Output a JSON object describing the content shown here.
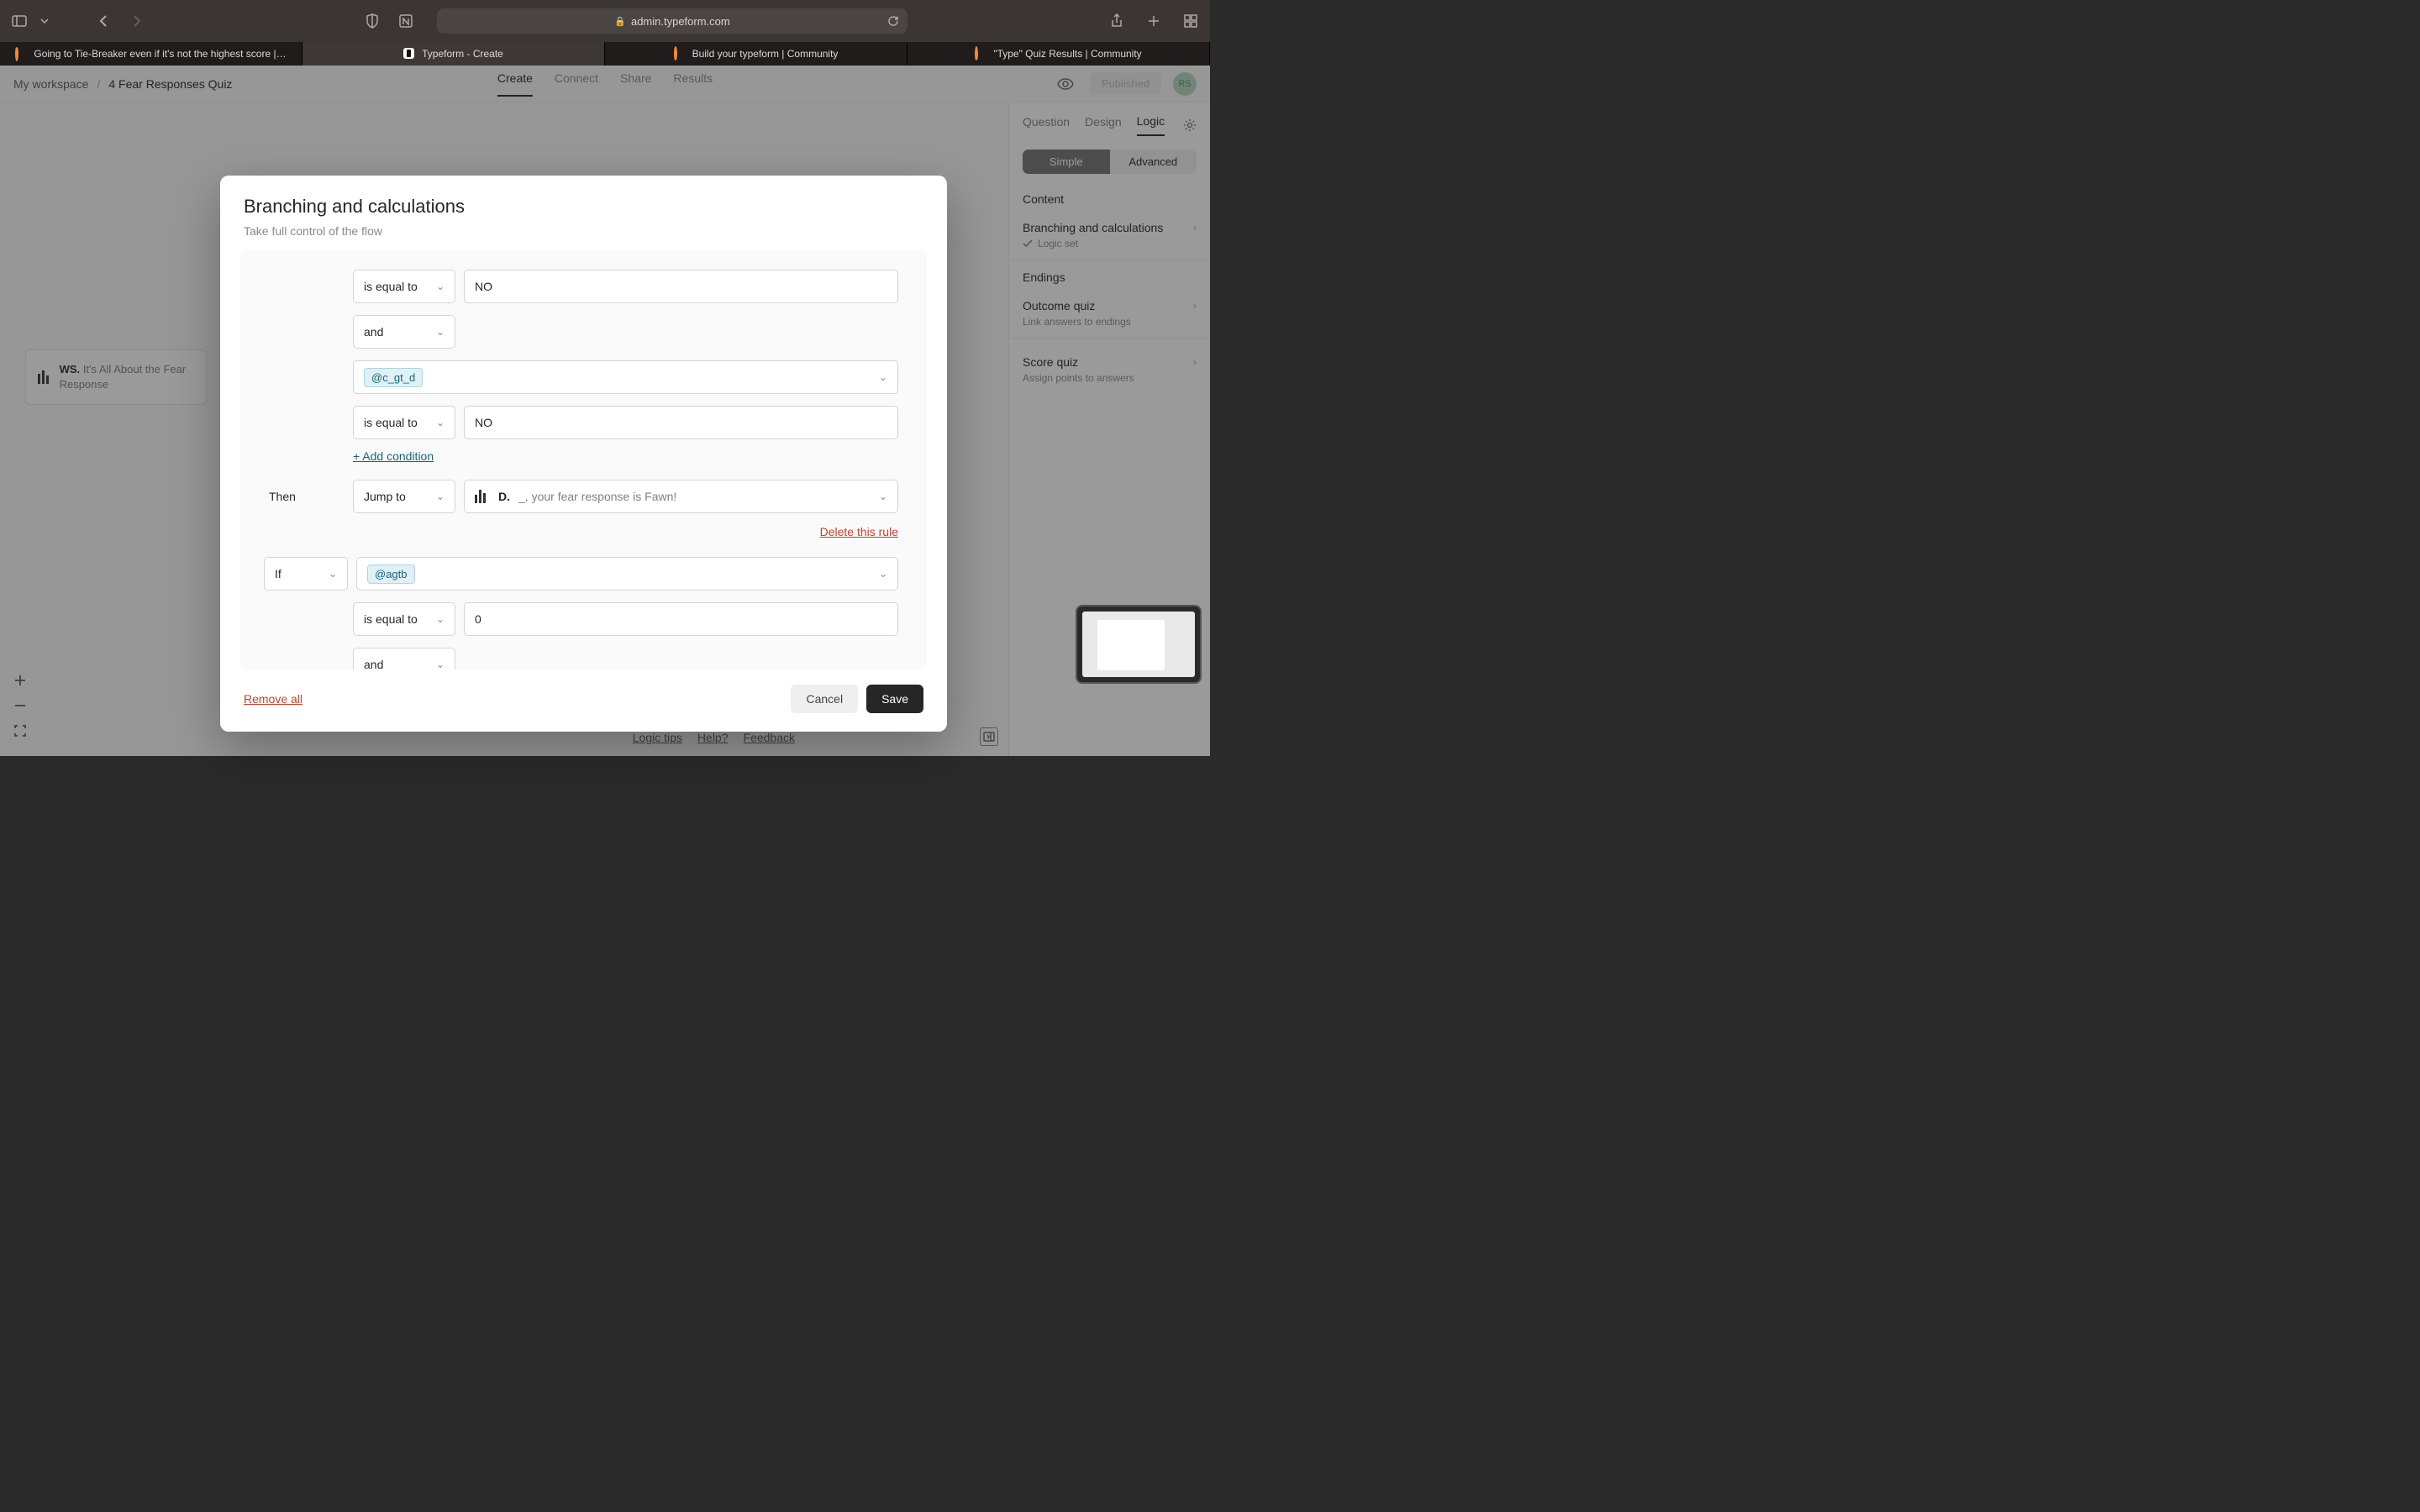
{
  "browser": {
    "url": "admin.typeform.com",
    "tabs": [
      {
        "label": "Going to Tie-Breaker even if it's not the highest score |…"
      },
      {
        "label": "Typeform - Create"
      },
      {
        "label": "Build your typeform | Community"
      },
      {
        "label": "\"Type\" Quiz Results | Community"
      }
    ]
  },
  "breadcrumb": {
    "workspace": "My workspace",
    "form": "4 Fear Responses Quiz"
  },
  "topnav": {
    "create": "Create",
    "connect": "Connect",
    "share": "Share",
    "results": "Results"
  },
  "header": {
    "publish": "Published",
    "avatar": "RS"
  },
  "card": {
    "prefix": "WS.",
    "text": "It's All About the Fear Response"
  },
  "sidepanel": {
    "tabs": {
      "question": "Question",
      "design": "Design",
      "logic": "Logic"
    },
    "seg": {
      "simple": "Simple",
      "advanced": "Advanced"
    },
    "content_title": "Content",
    "branching": "Branching and calculations",
    "logic_set": "Logic set",
    "endings_title": "Endings",
    "outcome": "Outcome quiz",
    "outcome_sub": "Link answers to endings",
    "score": "Score quiz",
    "score_sub": "Assign points to answers"
  },
  "modal": {
    "title": "Branching and calculations",
    "subtitle": "Take full control of the flow",
    "op_equal": "is equal to",
    "val_no": "NO",
    "conj_and": "and",
    "var_cgtd": "@c_gt_d",
    "add_condition": "+ Add condition",
    "then": "Then",
    "jump_to": "Jump to",
    "dest_letter": "D.",
    "dest_text": "_, your fear response is Fawn!",
    "delete_rule": "Delete this rule",
    "if": "If",
    "var_agtb": "@agtb",
    "val_zero": "0",
    "remove_all": "Remove all",
    "cancel": "Cancel",
    "save": "Save"
  },
  "footer": {
    "tips": "Logic tips",
    "help": "Help?",
    "feedback": "Feedback"
  }
}
